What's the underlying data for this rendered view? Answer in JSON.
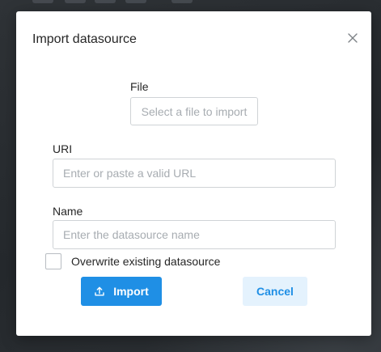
{
  "dialog": {
    "title": "Import datasource",
    "close_label": "×"
  },
  "file": {
    "label": "File",
    "button_text": "Select a file to import"
  },
  "uri": {
    "label": "URI",
    "placeholder": "Enter or paste a valid URL",
    "value": ""
  },
  "name": {
    "label": "Name",
    "placeholder": "Enter the datasource name",
    "value": ""
  },
  "overwrite": {
    "label": "Overwrite existing datasource",
    "checked": false
  },
  "actions": {
    "import_label": "Import",
    "import_icon": "upload-icon",
    "cancel_label": "Cancel"
  },
  "colors": {
    "primary": "#1f8fe5",
    "secondary_bg": "#e4f2fd",
    "backdrop": "#2b2f33"
  }
}
